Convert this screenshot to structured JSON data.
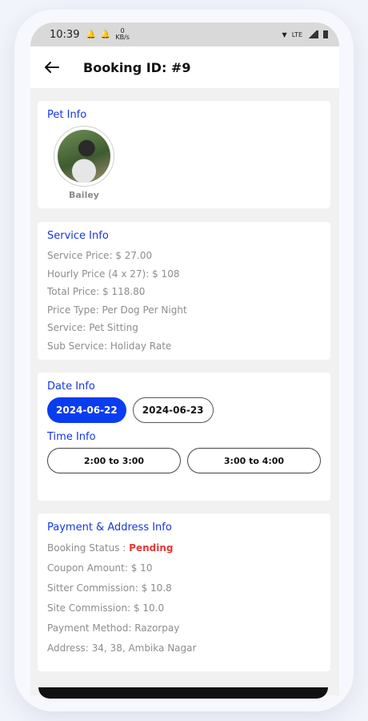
{
  "status_bar": {
    "time": "10:39",
    "speed_value": "0",
    "speed_unit": "KB/s",
    "network": "LTE"
  },
  "app_bar": {
    "title": "Booking ID: #9"
  },
  "pet_info": {
    "title": "Pet Info",
    "name": "Bailey"
  },
  "service_info": {
    "title": "Service Info",
    "rows": [
      {
        "label": "Service Price",
        "value": "$ 27.00"
      },
      {
        "label": "Hourly Price (4 x 27)",
        "value": "$ 108"
      },
      {
        "label": "Total Price",
        "value": "$ 118.80"
      },
      {
        "label": "Price Type",
        "value": "Per Dog Per Night"
      },
      {
        "label": "Service",
        "value": "Pet Sitting"
      },
      {
        "label": "Sub Service",
        "value": "Holiday Rate"
      }
    ]
  },
  "date_info": {
    "title": "Date Info",
    "dates": [
      "2024-06-22",
      "2024-06-23"
    ],
    "selected_index": 0
  },
  "time_info": {
    "title": "Time Info",
    "slots": [
      "2:00 to 3:00",
      "3:00 to 4:00"
    ]
  },
  "payment_info": {
    "title": "Payment & Address Info",
    "booking_status_label": "Booking Status",
    "booking_status_value": "Pending",
    "rows": [
      {
        "label": "Coupon Amount",
        "value": "$ 10"
      },
      {
        "label": "Sitter Commission",
        "value": "$ 10.8"
      },
      {
        "label": "Site Commission",
        "value": "$ 10.0"
      },
      {
        "label": "Payment Method",
        "value": "Razorpay"
      },
      {
        "label": "Address",
        "value": "34, 38, Ambika Nagar"
      }
    ]
  },
  "colors": {
    "accent": "#1436e6",
    "chip_active": "#0a3df0",
    "pending": "#e53935"
  }
}
